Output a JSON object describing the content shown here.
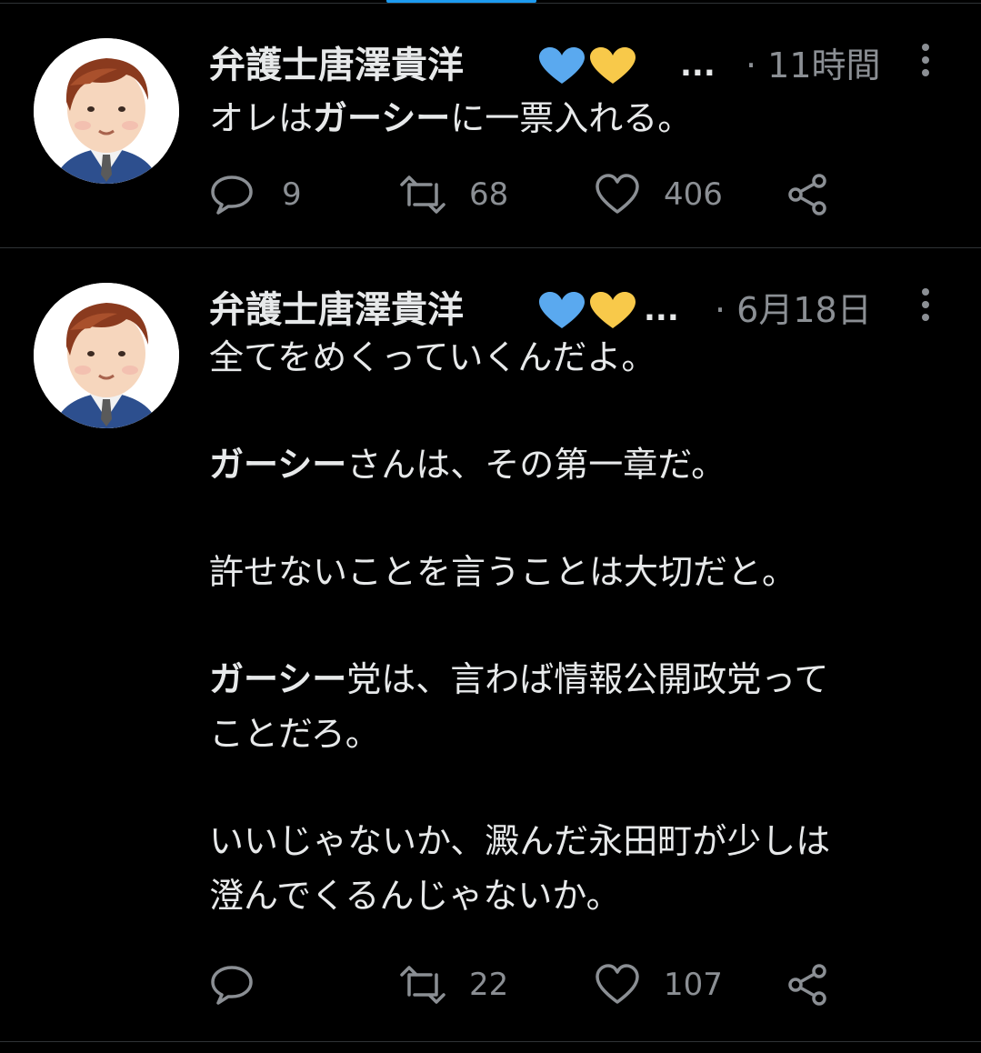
{
  "tweets": [
    {
      "author": "弁護士唐澤貴洋",
      "ellipsis": "...",
      "time": "· 11時間",
      "lines": [
        [
          {
            "t": "オレは",
            "b": false
          },
          {
            "t": "ガーシー",
            "b": true
          },
          {
            "t": "に一票入れる。",
            "b": false
          }
        ]
      ],
      "counts": {
        "reply": "9",
        "retweet": "68",
        "like": "406"
      }
    },
    {
      "author": "弁護士唐澤貴洋",
      "ellipsis": "...",
      "time": "· 6月18日",
      "lines": [
        [
          {
            "t": "全てをめくっていくんだよ。",
            "b": false
          }
        ],
        [],
        [
          {
            "t": "ガーシー",
            "b": true
          },
          {
            "t": "さんは、その第一章だ。",
            "b": false
          }
        ],
        [],
        [
          {
            "t": "許せないことを言うことは大切だと。",
            "b": false
          }
        ],
        [],
        [
          {
            "t": "ガーシー",
            "b": true
          },
          {
            "t": "党は、言わば情報公開政党って",
            "b": false
          }
        ],
        [
          {
            "t": "ことだろ。",
            "b": false
          }
        ],
        [],
        [
          {
            "t": "いいじゃないか、澱んだ永田町が少しは",
            "b": false
          }
        ],
        [
          {
            "t": "澄んでくるんじゃないか。",
            "b": false
          }
        ]
      ],
      "counts": {
        "reply": "",
        "retweet": "22",
        "like": "107"
      }
    }
  ],
  "icons": {
    "reply": "speech-bubble-icon",
    "retweet": "retweet-arrows-icon",
    "like": "heart-outline-icon",
    "share": "share-nodes-icon",
    "more": "vertical-dots-icon",
    "hearts": [
      "blue-heart-emoji",
      "yellow-heart-emoji"
    ]
  },
  "colors": {
    "background": "#000000",
    "text": "#e7e9ea",
    "muted": "#8b8f94",
    "divider": "#2f3336",
    "blue_heart": "#5aa9ef",
    "yellow_heart": "#f8c94a"
  }
}
